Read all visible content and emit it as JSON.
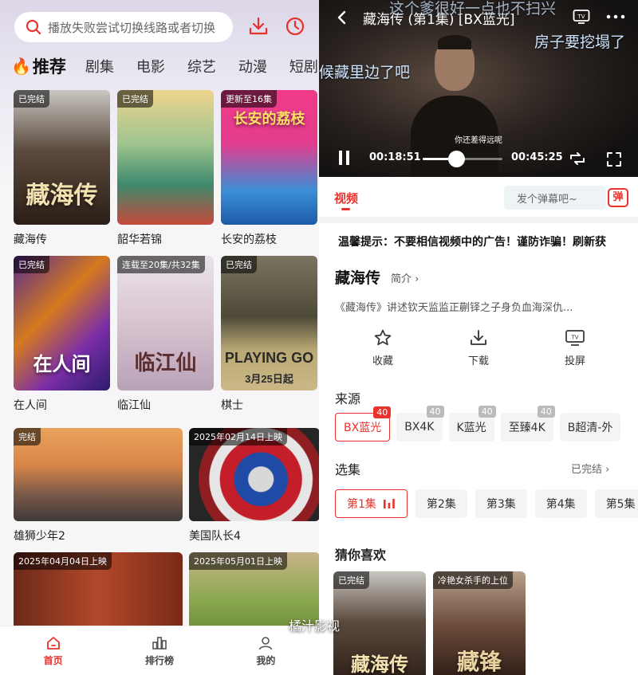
{
  "left": {
    "search": {
      "placeholder": "播放失败尝试切换线路或者切换"
    },
    "top_icons": [
      "download-icon",
      "history-icon"
    ],
    "categories": [
      {
        "label": "推荐",
        "active": true,
        "icon": "fire-icon"
      },
      {
        "label": "剧集"
      },
      {
        "label": "电影"
      },
      {
        "label": "综艺"
      },
      {
        "label": "动漫"
      },
      {
        "label": "短剧"
      }
    ],
    "cards": [
      {
        "title": "藏海传",
        "badge": "已完结",
        "poster_text": "藏海传"
      },
      {
        "title": "韶华若锦",
        "badge": "已完结"
      },
      {
        "title": "长安的荔枝",
        "badge": "更新至16集",
        "poster_text": "长安的荔枝"
      },
      {
        "title": "在人间",
        "badge": "已完结",
        "poster_text": "在人间"
      },
      {
        "title": "临江仙",
        "badge": "连载至20集/共32集",
        "poster_text": "临江仙"
      },
      {
        "title": "棋士",
        "badge": "已完结",
        "poster_text": "PLAYING GO",
        "poster_sub": "3月25日起"
      },
      {
        "title": "雄狮少年2",
        "badge": "完结"
      },
      {
        "title": "美国队长4",
        "badge": "2025年02月14日上映"
      },
      {
        "title": "",
        "badge": "2025年04月04日上映"
      },
      {
        "title": "",
        "badge": "2025年05月01日上映"
      }
    ],
    "bottom_nav": [
      {
        "label": "首页",
        "icon": "home-icon",
        "active": true
      },
      {
        "label": "排行榜",
        "icon": "ranking-icon"
      },
      {
        "label": "我的",
        "icon": "profile-icon"
      }
    ]
  },
  "right": {
    "player": {
      "title": "藏海传 (第1集) [BX蓝光]",
      "danmu": [
        "这个爹很好一点也不扫兴",
        "房子要挖塌了",
        "候藏里边了吧"
      ],
      "subtitle": "你还差得远呢",
      "current_time": "00:18:51",
      "total_time": "00:45:25",
      "progress": 0.415
    },
    "video_tab": "视频",
    "danmu_placeholder": "发个弹幕吧~",
    "danmu_button": "弹",
    "notice": "温馨提示：不要相信视频中的广告！谨防诈骗！刷新获",
    "show": {
      "title": "藏海传",
      "intro_label": "简介",
      "synopsis": "《藏海传》讲述钦天监监正蒯铎之子身负血海深仇..."
    },
    "actions": [
      {
        "label": "收藏",
        "icon": "star-icon"
      },
      {
        "label": "下载",
        "icon": "download-icon"
      },
      {
        "label": "投屏",
        "icon": "cast-tv-icon"
      }
    ],
    "source_title": "来源",
    "sources": [
      {
        "label": "BX蓝光",
        "count": "40",
        "active": true
      },
      {
        "label": "BX4K",
        "count": "40"
      },
      {
        "label": "K蓝光",
        "count": "40"
      },
      {
        "label": "至臻4K",
        "count": "40"
      },
      {
        "label": "B超清-外"
      }
    ],
    "episodes_title": "选集",
    "episodes_status": "已完结",
    "episodes": [
      {
        "label": "第1集",
        "active": true
      },
      {
        "label": "第2集"
      },
      {
        "label": "第3集"
      },
      {
        "label": "第4集"
      },
      {
        "label": "第5集"
      }
    ],
    "recommend_title": "猜你喜欢",
    "recommend": [
      {
        "badge": "已完结",
        "poster_text": "藏海传"
      },
      {
        "badge": "冷艳女杀手的上位",
        "poster_text": "藏锋"
      }
    ],
    "watermark": "橘汁影视"
  }
}
